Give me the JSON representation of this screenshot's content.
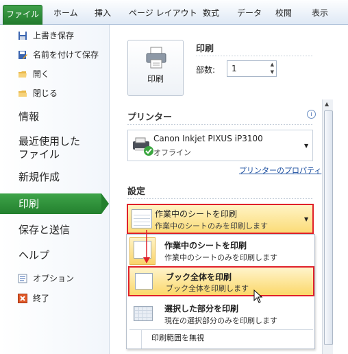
{
  "ribbon": {
    "file_tab": "ファイル",
    "tabs": [
      "ホーム",
      "挿入",
      "ページ レイアウト",
      "数式",
      "データ",
      "校閲",
      "表示"
    ]
  },
  "sidebar": {
    "small_top": [
      "上書き保存",
      "名前を付けて保存",
      "開く",
      "閉じる"
    ],
    "info": "情報",
    "recent_line1": "最近使用した",
    "recent_line2": "ファイル",
    "new": "新規作成",
    "print": "印刷",
    "save_send": "保存と送信",
    "help": "ヘルプ",
    "options": "オプション",
    "exit": "終了"
  },
  "print": {
    "section_title": "印刷",
    "button_label": "印刷",
    "copies_label": "部数:",
    "copies_value": "1"
  },
  "printer": {
    "section_title": "プリンター",
    "name": "Canon Inkjet PIXUS iP3100",
    "status": "オフライン",
    "properties_link": "プリンターのプロパティ"
  },
  "settings": {
    "section_title": "設定",
    "selected_title": "作業中のシートを印刷",
    "selected_sub": "作業中のシートのみを印刷します",
    "menu": [
      {
        "title": "作業中のシートを印刷",
        "sub": "作業中のシートのみを印刷します"
      },
      {
        "title": "ブック全体を印刷",
        "sub": "ブック全体を印刷します"
      },
      {
        "title": "選択した部分を印刷",
        "sub": "現在の選択部分のみを印刷します"
      }
    ],
    "ignore_area": "印刷範囲を無視"
  },
  "colors": {
    "file_green": "#2f8f3a",
    "highlight_red": "#e0202a",
    "hover_yellow": "#fbe28a"
  }
}
